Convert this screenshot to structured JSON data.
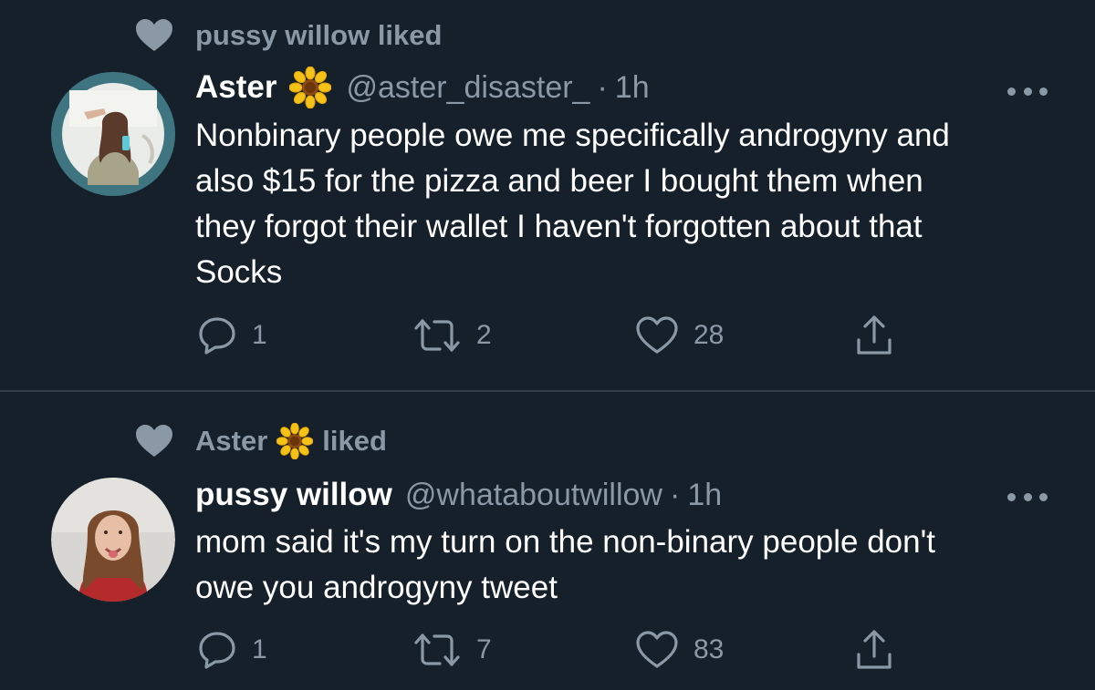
{
  "tweets": [
    {
      "social_context": {
        "prefix": "pussy willow liked"
      },
      "author": {
        "display_name": "Aster",
        "handle": "@aster_disaster_",
        "badge_icon": "sunflower-emoji-icon"
      },
      "time": "1h",
      "separator": "·",
      "text": "Nonbinary people owe me specifically androgyny and\nalso $15 for the pizza and beer I bought them when\nthey forgot their wallet I haven't forgotten about that\nSocks",
      "stats": {
        "replies": "1",
        "retweets": "2",
        "likes": "28"
      }
    },
    {
      "social_context": {
        "name": "Aster",
        "suffix": "liked",
        "badge_icon": "sunflower-emoji-icon"
      },
      "author": {
        "display_name": "pussy willow",
        "handle": "@whataboutwillow"
      },
      "time": "1h",
      "separator": "·",
      "text": "mom said it's my turn on the non-binary people don't\nowe you androgyny tweet",
      "stats": {
        "replies": "1",
        "retweets": "7",
        "likes": "83"
      }
    }
  ],
  "colors": {
    "background": "#15202b",
    "secondary_text": "#8b98a5",
    "primary_text": "#ffffff",
    "avatar_ring": "#3f7580"
  }
}
